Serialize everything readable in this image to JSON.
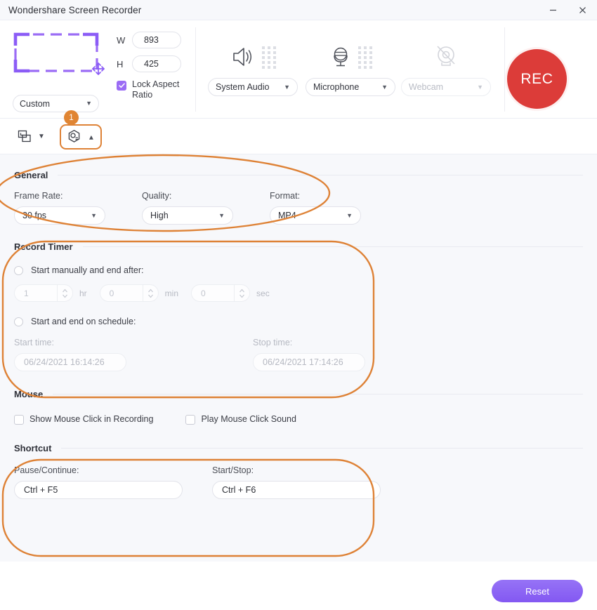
{
  "window": {
    "title": "Wondershare Screen Recorder",
    "minimize_label": "minimize",
    "close_label": "close"
  },
  "header": {
    "capture": {
      "mode_label": "Custom",
      "width_label": "W",
      "width_value": "893",
      "height_label": "H",
      "height_value": "425",
      "lock_aspect_label": "Lock Aspect Ratio",
      "lock_aspect_checked": true
    },
    "devices": [
      {
        "icon": "speaker-icon",
        "label": "System Audio",
        "enabled": true
      },
      {
        "icon": "microphone-icon",
        "label": "Microphone",
        "enabled": true
      },
      {
        "icon": "webcam-off-icon",
        "label": "Webcam",
        "enabled": false
      }
    ],
    "record_button_label": "REC"
  },
  "toolbar": {
    "screenshot_label": "screenshot-tool",
    "settings_label": "settings-tool",
    "badge_number": "1"
  },
  "settings": {
    "general": {
      "title": "General",
      "fields": [
        {
          "label": "Frame Rate:",
          "value": "30 fps"
        },
        {
          "label": "Quality:",
          "value": "High"
        },
        {
          "label": "Format:",
          "value": "MP4"
        }
      ]
    },
    "record_timer": {
      "title": "Record Timer",
      "manual_option_label": "Start manually and end after:",
      "manual_selected": false,
      "duration": [
        {
          "value": "1",
          "unit": "hr"
        },
        {
          "value": "0",
          "unit": "min"
        },
        {
          "value": "0",
          "unit": "sec"
        }
      ],
      "schedule_option_label": "Start and end on schedule:",
      "schedule_selected": false,
      "start_time_label": "Start time:",
      "start_time_value": "06/24/2021 16:14:26",
      "stop_time_label": "Stop time:",
      "stop_time_value": "06/24/2021 17:14:26"
    },
    "mouse": {
      "title": "Mouse",
      "options": [
        {
          "label": "Show Mouse Click in Recording",
          "checked": false
        },
        {
          "label": "Play Mouse Click Sound",
          "checked": false
        }
      ]
    },
    "shortcut": {
      "title": "Shortcut",
      "fields": [
        {
          "label": "Pause/Continue:",
          "value": "Ctrl + F5"
        },
        {
          "label": "Start/Stop:",
          "value": "Ctrl + F6"
        }
      ]
    }
  },
  "footer": {
    "reset_label": "Reset"
  },
  "colors": {
    "accent_purple": "#8c63f4",
    "record_red": "#dc3c39",
    "annotation_orange": "#de8236",
    "panel_bg": "#f7f8fb"
  }
}
